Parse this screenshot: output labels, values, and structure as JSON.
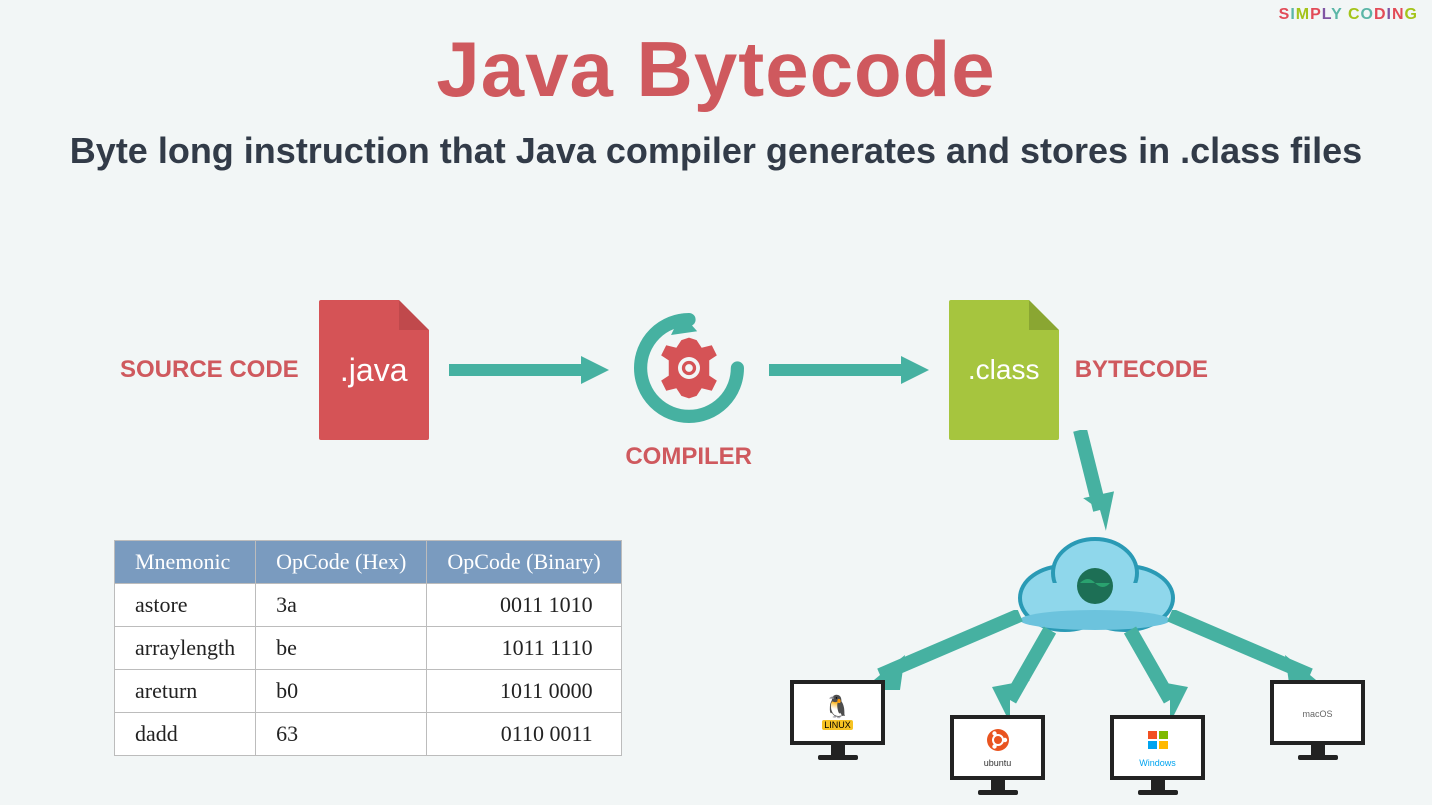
{
  "brand": "SIMPLY CODING",
  "title": "Java Bytecode",
  "subtitle": "Byte long instruction that Java compiler generates and stores in .class files",
  "flow": {
    "source_label": "SOURCE CODE",
    "java_file_label": ".java",
    "compiler_label": "COMPILER",
    "class_file_label": ".class",
    "bytecode_label": "BYTECODE"
  },
  "table": {
    "headers": [
      "Mnemonic",
      "OpCode (Hex)",
      "OpCode (Binary)"
    ],
    "rows": [
      {
        "mnemonic": "astore",
        "hex": "3a",
        "bin": "0011 1010"
      },
      {
        "mnemonic": "arraylength",
        "hex": "be",
        "bin": "1011 1110"
      },
      {
        "mnemonic": "areturn",
        "hex": "b0",
        "bin": "1011 0000"
      },
      {
        "mnemonic": "dadd",
        "hex": "63",
        "bin": "0110 0011"
      }
    ]
  },
  "platforms": [
    {
      "name": "Linux",
      "label": "LINUX"
    },
    {
      "name": "Ubuntu",
      "label": "ubuntu"
    },
    {
      "name": "Windows",
      "label": "Windows"
    },
    {
      "name": "macOS",
      "label": "macOS"
    }
  ],
  "colors": {
    "accent_red": "#cf595e",
    "accent_teal": "#46b1a1",
    "accent_green": "#a6c53e",
    "table_header": "#7a9bbf",
    "text_dark": "#323b48"
  }
}
